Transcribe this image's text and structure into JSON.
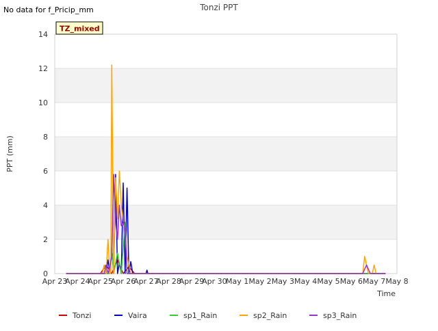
{
  "notice": "No data for f_Pricip_mm",
  "chart_data": {
    "type": "line",
    "title": "Tonzi PPT",
    "xlabel": "Time",
    "ylabel": "PPT (mm)",
    "ylim": [
      0,
      14
    ],
    "yticks": [
      0,
      2,
      4,
      6,
      8,
      10,
      12,
      14
    ],
    "xlim": [
      "2024-04-23",
      "2024-05-08"
    ],
    "xtick_labels": [
      "Apr 23",
      "Apr 24",
      "Apr 25",
      "Apr 26",
      "Apr 27",
      "Apr 28",
      "Apr 29",
      "Apr 30",
      "May 1",
      "May 2",
      "May 3",
      "May 4",
      "May 5",
      "May 6",
      "May 7",
      "May 8"
    ],
    "grid": true,
    "legend_position": "bottom",
    "annotation": "TZ_mixed",
    "series": [
      {
        "name": "Tonzi",
        "color": "#cc0000",
        "x": [
          "2024-04-23 12:00",
          "2024-04-25 00:00",
          "2024-04-25 06:00",
          "2024-04-25 12:00",
          "2024-04-25 18:00",
          "2024-04-26 00:00",
          "2024-04-26 06:00",
          "2024-04-26 12:00",
          "2024-05-07 12:00"
        ],
        "y": [
          0,
          0,
          0.5,
          0,
          0.8,
          0,
          0.4,
          0,
          0
        ]
      },
      {
        "name": "Vaira",
        "color": "#0000cc",
        "x": [
          "2024-04-23 12:00",
          "2024-04-25 06:00",
          "2024-04-25 08:00",
          "2024-04-25 10:00",
          "2024-04-25 12:00",
          "2024-04-25 14:00",
          "2024-04-25 16:00",
          "2024-04-25 18:00",
          "2024-04-25 20:00",
          "2024-04-25 22:00",
          "2024-04-26 00:00",
          "2024-04-26 02:00",
          "2024-04-26 04:00",
          "2024-04-26 06:00",
          "2024-04-26 08:00",
          "2024-04-26 10:00",
          "2024-04-26 12:00",
          "2024-04-26 14:00",
          "2024-04-26 16:00",
          "2024-04-26 18:00",
          "2024-04-26 20:00",
          "2024-04-26 22:00",
          "2024-04-27 00:00",
          "2024-04-27 01:00",
          "2024-04-27 02:00",
          "2024-05-07 12:00"
        ],
        "y": [
          0,
          0,
          0.8,
          0,
          1.5,
          0,
          5.8,
          0,
          0.6,
          0,
          5.3,
          0,
          5.0,
          0,
          0.7,
          0,
          0,
          0,
          0,
          0,
          0,
          0,
          0,
          0.2,
          0,
          0
        ]
      },
      {
        "name": "sp1_Rain",
        "color": "#33cc33",
        "x": [
          "2024-04-23 12:00",
          "2024-04-25 10:00",
          "2024-04-25 12:00",
          "2024-04-25 14:00",
          "2024-04-25 18:00",
          "2024-04-25 22:00",
          "2024-04-26 02:00",
          "2024-04-26 04:00",
          "2024-05-07 12:00"
        ],
        "y": [
          0,
          0,
          1.5,
          0,
          1.2,
          0,
          3.0,
          0,
          0
        ]
      },
      {
        "name": "sp2_Rain",
        "color": "#ffa500",
        "x": [
          "2024-04-23 12:00",
          "2024-04-25 02:00",
          "2024-04-25 04:00",
          "2024-04-25 06:00",
          "2024-04-25 08:00",
          "2024-04-25 10:00",
          "2024-04-25 11:00",
          "2024-04-25 12:00",
          "2024-04-25 14:00",
          "2024-04-25 15:00",
          "2024-04-25 16:00",
          "2024-04-25 18:00",
          "2024-04-25 20:00",
          "2024-04-25 22:00",
          "2024-04-26 00:00",
          "2024-04-26 02:00",
          "2024-04-26 04:00",
          "2024-04-26 06:00",
          "2024-04-26 08:00",
          "2024-05-06 12:00",
          "2024-05-06 14:00",
          "2024-05-06 18:00",
          "2024-05-06 22:00",
          "2024-05-07 00:00",
          "2024-05-07 02:00",
          "2024-05-07 12:00"
        ],
        "y": [
          0,
          0,
          0.5,
          0,
          2.0,
          0,
          0,
          12.2,
          0,
          3.0,
          5.6,
          3.2,
          6.0,
          4.0,
          3.0,
          2.5,
          1.0,
          0.5,
          0,
          0,
          1.0,
          0,
          0,
          0.5,
          0,
          0
        ]
      },
      {
        "name": "sp3_Rain",
        "color": "#9933cc",
        "x": [
          "2024-04-23 12:00",
          "2024-04-25 04:00",
          "2024-04-25 06:00",
          "2024-04-25 08:00",
          "2024-04-25 10:00",
          "2024-04-25 12:00",
          "2024-04-25 14:00",
          "2024-04-25 16:00",
          "2024-04-25 18:00",
          "2024-04-25 20:00",
          "2024-04-25 22:00",
          "2024-04-26 00:00",
          "2024-04-26 02:00",
          "2024-04-26 04:00",
          "2024-04-26 06:00",
          "2024-05-06 12:00",
          "2024-05-06 16:00",
          "2024-05-06 20:00",
          "2024-05-07 12:00"
        ],
        "y": [
          0,
          0,
          0.5,
          0,
          0.4,
          1.0,
          5.8,
          3.0,
          2.0,
          4.0,
          2.8,
          3.0,
          2.6,
          0,
          0,
          0,
          0.5,
          0,
          0
        ]
      }
    ]
  }
}
